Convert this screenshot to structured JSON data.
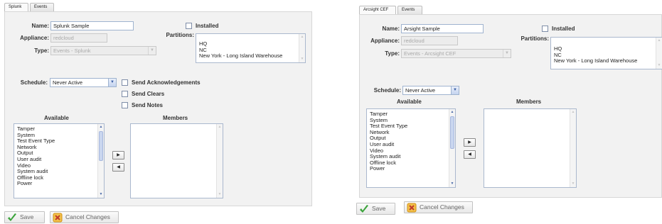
{
  "left": {
    "tabs": [
      "Splunk",
      "Events"
    ],
    "name_label": "Name:",
    "name_value": "Splunk Sample",
    "appliance_label": "Appliance:",
    "appliance_value": "redcloud",
    "type_label": "Type:",
    "type_value": "Events - Splunk",
    "installed_label": "Installed",
    "partitions_label": "Partitions:",
    "partitions": [
      "HQ",
      "NC",
      "New York - Long Island Warehouse"
    ],
    "schedule_label": "Schedule:",
    "schedule_value": "Never Active",
    "checks": [
      "Send Acknowledgements",
      "Send Clears",
      "Send Notes"
    ],
    "available_label": "Available",
    "members_label": "Members",
    "available": [
      "Tamper",
      "System",
      "Test Event Type",
      "Network",
      "Output",
      "User audit",
      "Video",
      "System audit",
      "Offline lock",
      "Power"
    ],
    "save_label": "Save",
    "cancel_label": "Cancel Changes"
  },
  "right": {
    "tabs": [
      "Arcsight CEF",
      "Events"
    ],
    "name_label": "Name:",
    "name_value": "Arsight Sample",
    "appliance_label": "Appliance:",
    "appliance_value": "redcloud",
    "type_label": "Type:",
    "type_value": "Events - Arcsight CEF",
    "installed_label": "Installed",
    "partitions_label": "Partitions:",
    "partitions": [
      "HQ",
      "NC",
      "New York - Long Island Warehouse"
    ],
    "schedule_label": "Schedule:",
    "schedule_value": "Never Active",
    "available_label": "Available",
    "members_label": "Members",
    "available": [
      "Tamper",
      "System",
      "Test Event Type",
      "Network",
      "Output",
      "User audit",
      "Video",
      "System audit",
      "Offline lock",
      "Power"
    ],
    "save_label": "Save",
    "cancel_label": "Cancel Changes"
  },
  "icons": {
    "move_right": "▶",
    "move_left": "◀",
    "dropdown": "▼",
    "scroll_up": "▲",
    "scroll_down": "▼"
  },
  "colors": {
    "save_check": "#3aa33a",
    "cancel_icon": "#e8a21a"
  }
}
